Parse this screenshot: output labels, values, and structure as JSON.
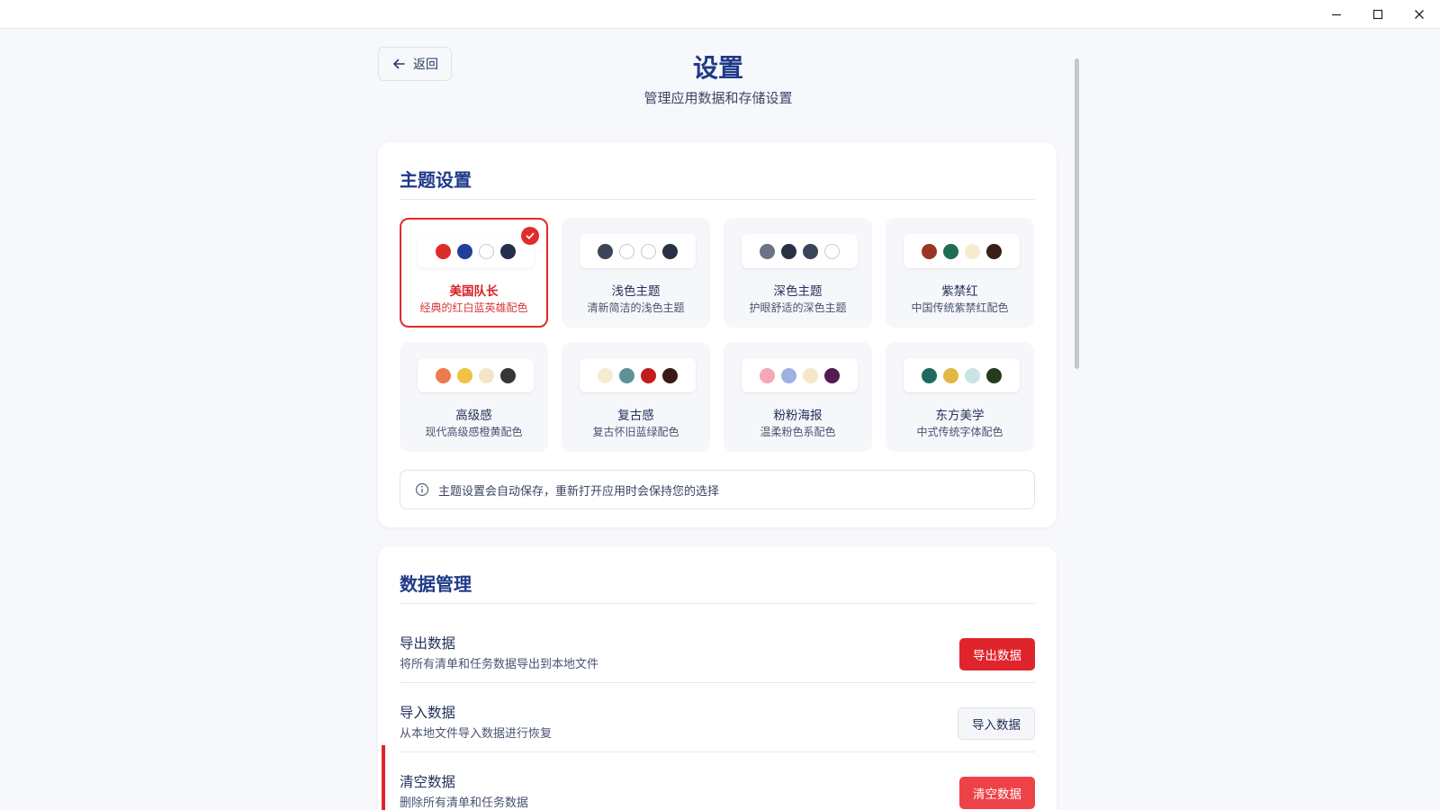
{
  "window": {
    "minimize_icon": "minimize-icon",
    "maximize_icon": "maximize-icon",
    "close_icon": "close-icon"
  },
  "header": {
    "back_label": "返回",
    "title": "设置",
    "subtitle": "管理应用数据和存储设置"
  },
  "theme_section": {
    "title": "主题设置",
    "themes": [
      {
        "name": "美国队长",
        "desc": "经典的红白蓝英雄配色",
        "colors": [
          "#e02b2b",
          "#233f9a",
          "#ffffff",
          "#27304a"
        ],
        "selected": true
      },
      {
        "name": "浅色主题",
        "desc": "清新简洁的浅色主题",
        "colors": [
          "#3d4659",
          "#ffffff",
          "#ffffff",
          "#2b3145"
        ],
        "selected": false
      },
      {
        "name": "深色主题",
        "desc": "护眼舒适的深色主题",
        "colors": [
          "#6b7384",
          "#2a3145",
          "#3b4458",
          "#ffffff"
        ],
        "selected": false
      },
      {
        "name": "紫禁红",
        "desc": "中国传统紫禁红配色",
        "colors": [
          "#9c3426",
          "#1e6e52",
          "#f5ecd0",
          "#3a1f18"
        ],
        "selected": false
      },
      {
        "name": "高级感",
        "desc": "现代高级感橙黄配色",
        "colors": [
          "#ee7a4b",
          "#f0c341",
          "#f3e6c6",
          "#363636"
        ],
        "selected": false
      },
      {
        "name": "复古感",
        "desc": "复古怀旧蓝绿配色",
        "colors": [
          "#f6ebd2",
          "#5f9296",
          "#c21c1c",
          "#3a1b18"
        ],
        "selected": false
      },
      {
        "name": "粉粉海报",
        "desc": "温柔粉色系配色",
        "colors": [
          "#f4a7b6",
          "#9fb1e3",
          "#f5e8c7",
          "#541b54"
        ],
        "selected": false
      },
      {
        "name": "东方美学",
        "desc": "中式传统字体配色",
        "colors": [
          "#1c6a62",
          "#e1b845",
          "#c8e4e4",
          "#233d1c"
        ],
        "selected": false
      }
    ],
    "info_text": "主题设置会自动保存，重新打开应用时会保持您的选择"
  },
  "data_section": {
    "title": "数据管理",
    "rows": [
      {
        "title": "导出数据",
        "desc": "将所有清单和任务数据导出到本地文件",
        "button": "导出数据"
      },
      {
        "title": "导入数据",
        "desc": "从本地文件导入数据进行恢复",
        "button": "导入数据"
      },
      {
        "title": "清空数据",
        "desc": "删除所有清单和任务数据",
        "button": "清空数据"
      }
    ]
  },
  "colors": {
    "accent": "#1f3a8a",
    "danger": "#e0242c"
  }
}
